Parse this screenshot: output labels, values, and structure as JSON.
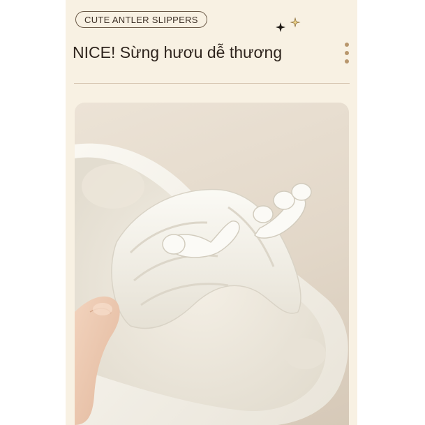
{
  "product": {
    "tag_label": "CUTE ANTLER SLIPPERS",
    "headline": "NICE! Sừng hươu dễ thương"
  },
  "colors": {
    "card_background": "#f8f1e3",
    "accent": "#b8976d",
    "text": "#2e241d"
  },
  "icons": {
    "sparkle": "sparkle-icon",
    "more": "more-vertical-icon"
  }
}
